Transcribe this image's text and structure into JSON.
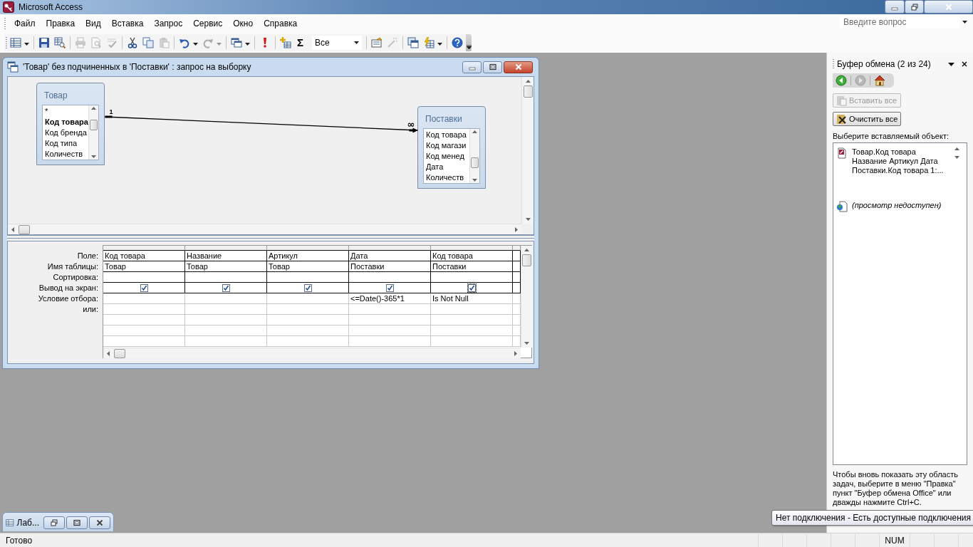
{
  "window": {
    "title": "Microsoft Access"
  },
  "menu": [
    "Файл",
    "Правка",
    "Вид",
    "Вставка",
    "Запрос",
    "Сервис",
    "Окно",
    "Справка"
  ],
  "help_box": {
    "placeholder": "Введите вопрос"
  },
  "toolbar": {
    "groups": [
      [
        {
          "kind": "datasheet",
          "disabled": false,
          "dropdown": true
        }
      ],
      [
        {
          "kind": "save",
          "disabled": false,
          "dropdown": false
        },
        {
          "kind": "table-search",
          "disabled": false,
          "dropdown": false
        }
      ],
      [
        {
          "kind": "print",
          "disabled": true,
          "dropdown": false
        },
        {
          "kind": "preview",
          "disabled": true,
          "dropdown": false
        },
        {
          "kind": "spell",
          "disabled": true,
          "dropdown": false
        }
      ],
      [
        {
          "kind": "cut",
          "disabled": false,
          "dropdown": false
        },
        {
          "kind": "copy",
          "disabled": false,
          "dropdown": false
        },
        {
          "kind": "paste",
          "disabled": true,
          "dropdown": false
        }
      ],
      [
        {
          "kind": "undo",
          "disabled": false,
          "dropdown": true
        },
        {
          "kind": "redo",
          "disabled": true,
          "dropdown": true
        }
      ],
      [
        {
          "kind": "window",
          "disabled": false,
          "dropdown": true
        }
      ],
      [
        {
          "kind": "run",
          "disabled": false,
          "dropdown": false
        }
      ],
      [
        {
          "kind": "show-table",
          "disabled": false,
          "dropdown": false
        },
        {
          "kind": "totals",
          "glyph": "Σ",
          "disabled": false,
          "dropdown": false
        },
        {
          "kind": "combo",
          "value": "Все",
          "disabled": false,
          "dropdown": true
        }
      ],
      [
        {
          "kind": "properties",
          "disabled": false,
          "dropdown": false
        },
        {
          "kind": "builder",
          "disabled": true,
          "dropdown": false
        }
      ],
      [
        {
          "kind": "db-window",
          "disabled": false,
          "dropdown": false
        },
        {
          "kind": "new-object",
          "disabled": false,
          "dropdown": true
        }
      ],
      [
        {
          "kind": "help",
          "disabled": false,
          "dropdown": false
        }
      ]
    ]
  },
  "query_window": {
    "title": "'Товар' без подчиненных в 'Поставки' : запрос на выборку",
    "tables": [
      {
        "name": "Товар",
        "fields": [
          {
            "name": "*",
            "primary_key": false
          },
          {
            "name": "Код товара",
            "primary_key": true
          },
          {
            "name": "Код бренда",
            "primary_key": false
          },
          {
            "name": "Код типа",
            "primary_key": false
          },
          {
            "name": "Количеств",
            "primary_key": false
          }
        ]
      },
      {
        "name": "Поставки",
        "fields": [
          {
            "name": "Код товара",
            "primary_key": false
          },
          {
            "name": "Код магази",
            "primary_key": false
          },
          {
            "name": "Код менед",
            "primary_key": false
          },
          {
            "name": "Дата",
            "primary_key": false
          },
          {
            "name": "Количеств",
            "primary_key": false
          }
        ]
      }
    ],
    "relationship": {
      "one_label": "1",
      "many_label": "∞"
    },
    "grid": {
      "row_labels": [
        "Поле:",
        "Имя таблицы:",
        "Сортировка:",
        "Вывод на экран:",
        "Условие отбора:",
        "или:"
      ],
      "columns": [
        {
          "field": "Код товара",
          "table": "Товар",
          "show": true,
          "focused": false
        },
        {
          "field": "Название",
          "table": "Товар",
          "show": true,
          "focused": false
        },
        {
          "field": "Артикул",
          "table": "Товар",
          "show": true,
          "focused": false
        },
        {
          "field": "Дата",
          "table": "Поставки",
          "show": true,
          "focused": false,
          "criteria": "<=Date()-365*1"
        },
        {
          "field": "Код товара",
          "table": "Поставки",
          "show": true,
          "focused": true,
          "criteria": "Is Not Null"
        }
      ]
    }
  },
  "task_pane": {
    "title": "Буфер обмена (2 из 24)",
    "nav": [
      {
        "kind": "back",
        "disabled": false
      },
      {
        "kind": "forward",
        "disabled": true
      },
      {
        "kind": "home",
        "disabled": false
      }
    ],
    "buttons": [
      {
        "kind": "paste-all",
        "label": "Вставить все",
        "disabled": true
      },
      {
        "kind": "clear-all",
        "label": "Очистить все",
        "disabled": false
      }
    ],
    "prompt": "Выберите вставляемый объект:",
    "items": [
      {
        "kind": "access",
        "text": "Товар.Код товара Название Артикул Дата Поставки.Код товара 1:..."
      },
      {
        "kind": "unavailable",
        "text": "(просмотр недоступен)"
      }
    ],
    "hint": "Чтобы вновь показать эту область задач, выберите в меню \"Правка\" пункт \"Буфер обмена Office\" или дважды нажмите Ctrl+C."
  },
  "minimized_window": {
    "title": "Лаб..."
  },
  "tooltip": {
    "text": "Нет подключения - Есть доступные подключения"
  },
  "status_bar": {
    "text": "Готово",
    "indicators": [
      "NUM"
    ]
  }
}
